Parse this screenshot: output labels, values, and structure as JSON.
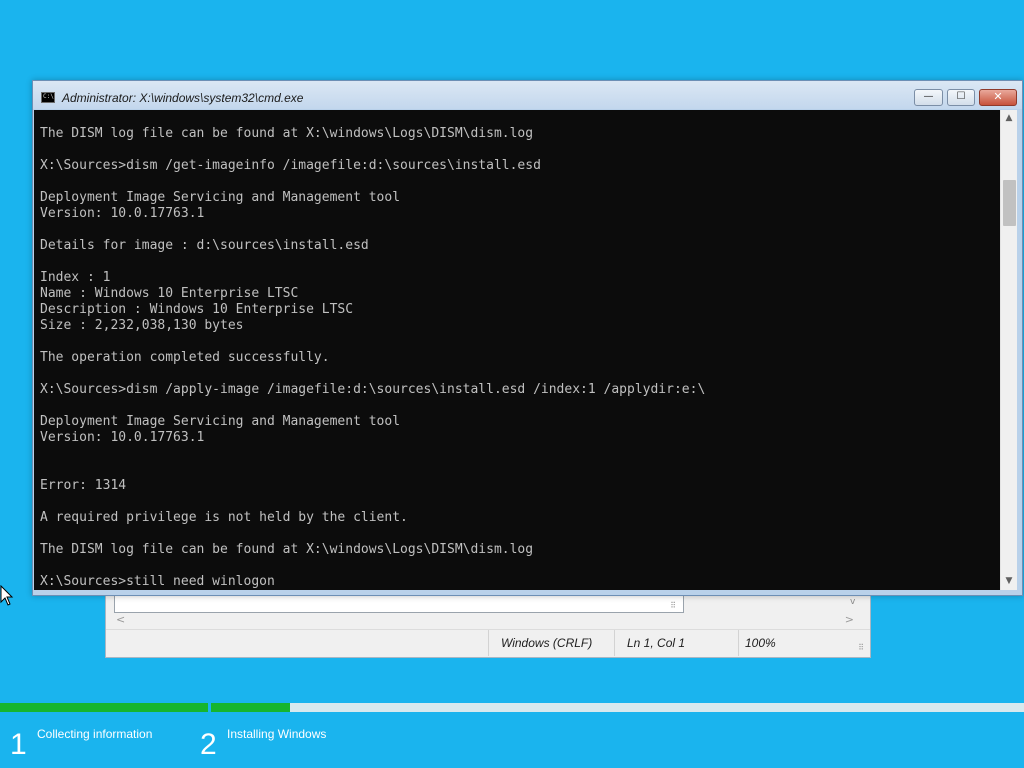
{
  "cmd_window": {
    "title": "Administrator: X:\\windows\\system32\\cmd.exe",
    "icon_label": "C:\\",
    "minimize_glyph": "—",
    "maximize_glyph": "☐",
    "close_glyph": "✕",
    "scroll_up_glyph": "▲",
    "scroll_down_glyph": "▼",
    "output": "The DISM log file can be found at X:\\windows\\Logs\\DISM\\dism.log\n\nX:\\Sources>dism /get-imageinfo /imagefile:d:\\sources\\install.esd\n\nDeployment Image Servicing and Management tool\nVersion: 10.0.17763.1\n\nDetails for image : d:\\sources\\install.esd\n\nIndex : 1\nName : Windows 10 Enterprise LTSC\nDescription : Windows 10 Enterprise LTSC\nSize : 2,232,038,130 bytes\n\nThe operation completed successfully.\n\nX:\\Sources>dism /apply-image /imagefile:d:\\sources\\install.esd /index:1 /applydir:e:\\\n\nDeployment Image Servicing and Management tool\nVersion: 10.0.17763.1\n\n\nError: 1314\n\nA required privilege is not held by the client.\n\nThe DISM log file can be found at X:\\windows\\Logs\\DISM\\dism.log\n\nX:\\Sources>still need winlogon"
  },
  "notepad": {
    "status_encoding": "Windows (CRLF)",
    "status_position": "Ln 1, Col 1",
    "status_zoom": "100%",
    "scroll_left_glyph": "<",
    "scroll_right_glyph": ">",
    "scroll_down_glyph": "v",
    "grip_glyph": "⠿"
  },
  "setup_progress": {
    "steps": [
      {
        "number": "1",
        "label": "Collecting information",
        "complete_fraction": 1.0
      },
      {
        "number": "2",
        "label": "Installing Windows",
        "complete_fraction": 0.1
      }
    ],
    "progress_color": "#16b52e"
  },
  "colors": {
    "desktop_background": "#1ab4ee",
    "console_background": "#0c0c0c",
    "console_text": "#c0c0c0"
  }
}
